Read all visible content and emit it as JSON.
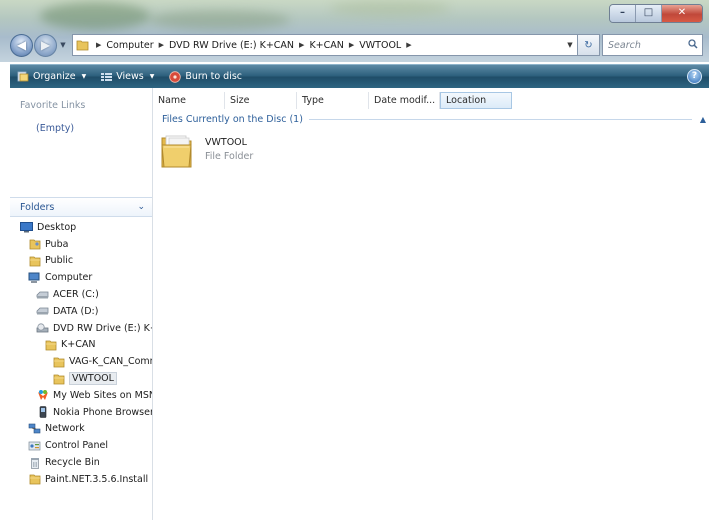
{
  "window": {
    "caption_buttons": {
      "minimize": "–",
      "maximize": "□",
      "close": "✕"
    }
  },
  "nav": {
    "back_icon": "back-arrow-icon",
    "forward_icon": "forward-arrow-icon",
    "breadcrumbs": [
      "Computer",
      "DVD RW Drive (E:) K+CAN",
      "K+CAN",
      "VWTOOL"
    ],
    "search_placeholder": "Search",
    "refresh_icon": "refresh-icon",
    "search_icon": "magnifier-icon"
  },
  "toolbar": {
    "organize_label": "Organize",
    "views_label": "Views",
    "burn_label": "Burn to disc",
    "help_label": "?"
  },
  "left_pane": {
    "favorites_header": "Favorite Links",
    "favorites_empty": "(Empty)",
    "folders_header": "Folders",
    "folders_chevron": "⌄",
    "tree": [
      {
        "label": "Desktop",
        "icon": "desktop-icon",
        "indent": 0
      },
      {
        "label": "Puba",
        "icon": "user-folder-icon",
        "indent": 1
      },
      {
        "label": "Public",
        "icon": "folder-icon",
        "indent": 1
      },
      {
        "label": "Computer",
        "icon": "computer-icon",
        "indent": 1
      },
      {
        "label": "ACER (C:)",
        "icon": "hard-drive-icon",
        "indent": 2
      },
      {
        "label": "DATA (D:)",
        "icon": "hard-drive-icon",
        "indent": 2
      },
      {
        "label": "DVD RW Drive (E:) K+CAN",
        "icon": "dvd-drive-icon",
        "indent": 2
      },
      {
        "label": "K+CAN",
        "icon": "folder-icon",
        "indent": 3
      },
      {
        "label": "VAG-K_CAN_Commander",
        "icon": "folder-icon",
        "indent": 4
      },
      {
        "label": "VWTOOL",
        "icon": "folder-icon",
        "indent": 4,
        "selected": true
      },
      {
        "label": "My Web Sites on MSN",
        "icon": "msn-icon",
        "indent": 2
      },
      {
        "label": "Nokia Phone Browser",
        "icon": "phone-icon",
        "indent": 2
      },
      {
        "label": "Network",
        "icon": "network-icon",
        "indent": 1
      },
      {
        "label": "Control Panel",
        "icon": "control-panel-icon",
        "indent": 1
      },
      {
        "label": "Recycle Bin",
        "icon": "recycle-bin-icon",
        "indent": 1
      },
      {
        "label": "Paint.NET.3.5.6.Install",
        "icon": "folder-icon",
        "indent": 1
      }
    ]
  },
  "main": {
    "columns": [
      "Name",
      "Size",
      "Type",
      "Date modif...",
      "Location"
    ],
    "group_title": "Files Currently on the Disc (1)",
    "group_chevron": "▲",
    "items": [
      {
        "name": "VWTOOL",
        "type": "File Folder"
      }
    ]
  },
  "colors": {
    "accent": "#2d5f9a",
    "toolbar": "#2c5f7c",
    "folder": "#e8c45c"
  }
}
